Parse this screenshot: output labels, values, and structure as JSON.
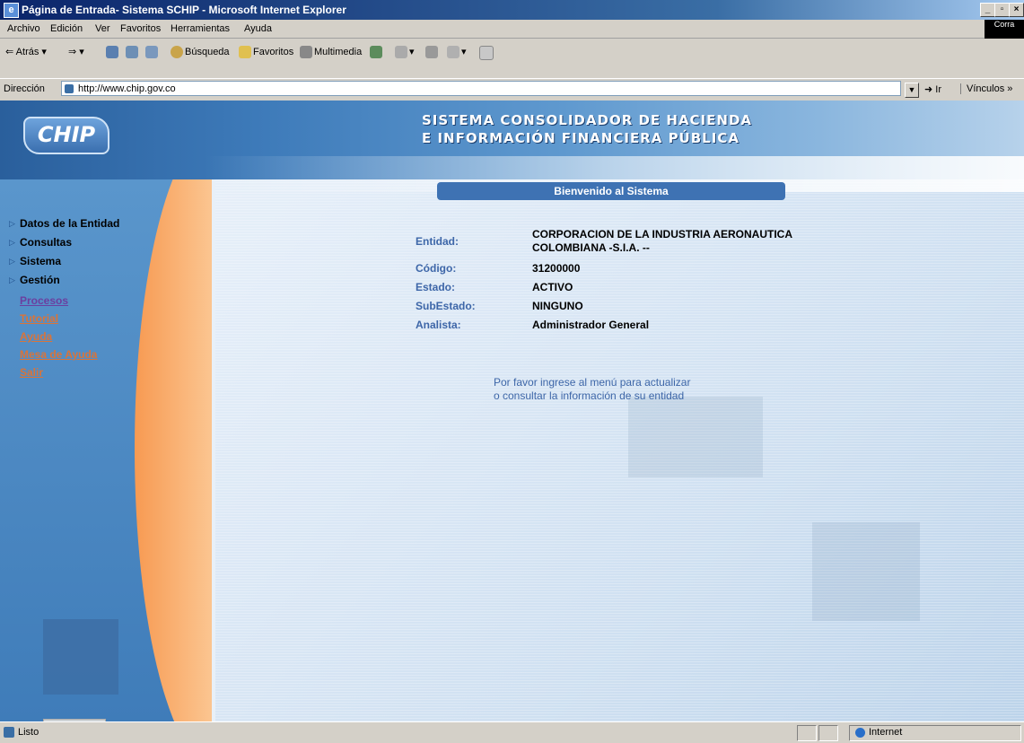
{
  "window": {
    "title": "Página de Entrada- Sistema SCHIP - Microsoft Internet Explorer",
    "controls": [
      "_",
      "▫",
      "×"
    ]
  },
  "menu": [
    "Archivo",
    "Edición",
    "Ver",
    "Favoritos",
    "Herramientas",
    "Ayuda"
  ],
  "corner_logo": "Corra",
  "toolbar": {
    "back": "Atrás",
    "search": "Búsqueda",
    "favorites": "Favoritos",
    "multimedia": "Multimedia"
  },
  "address": {
    "label": "Dirección",
    "url": "http://www.chip.gov.co",
    "go": "Ir",
    "links": "Vínculos »"
  },
  "banner": {
    "logo": "CHIP",
    "title_line1": "SISTEMA CONSOLIDADOR DE HACIENDA",
    "title_line2": "E INFORMACIÓN FINANCIERA PÚBLICA"
  },
  "sidebar": {
    "main_items": [
      "Datos de la Entidad",
      "Consultas",
      "Sistema",
      "Gestión"
    ],
    "sub_items": [
      "Procesos",
      "Tutorial",
      "Ayuda",
      "Mesa de Ayuda",
      "Salir"
    ]
  },
  "welcome": "Bienvenido al Sistema",
  "info": {
    "entidad_label": "Entidad:",
    "entidad_value_1": "CORPORACION DE LA INDUSTRIA AERONAUTICA",
    "entidad_value_2": "COLOMBIANA -S.I.A. --",
    "codigo_label": "Código:",
    "codigo_value": "31200000",
    "estado_label": "Estado:",
    "estado_value": "ACTIVO",
    "subestado_label": "SubEstado:",
    "subestado_value": "NINGUNO",
    "analista_label": "Analista:",
    "analista_value": "Administrador General"
  },
  "message": {
    "line1": "Por favor ingrese al menú para actualizar",
    "line2": "o consultar la información de su entidad"
  },
  "status": {
    "text": "Listo",
    "zone": "Internet"
  },
  "colors": {
    "title_bar": "#0a246a",
    "banner_blue": "#3d7ab9",
    "orange_curve": "#f79a52",
    "welcome_bar": "#3e72b3",
    "label_blue": "#3d66a8",
    "link_purple": "#6b3fa0",
    "link_orange": "#d9743a"
  }
}
